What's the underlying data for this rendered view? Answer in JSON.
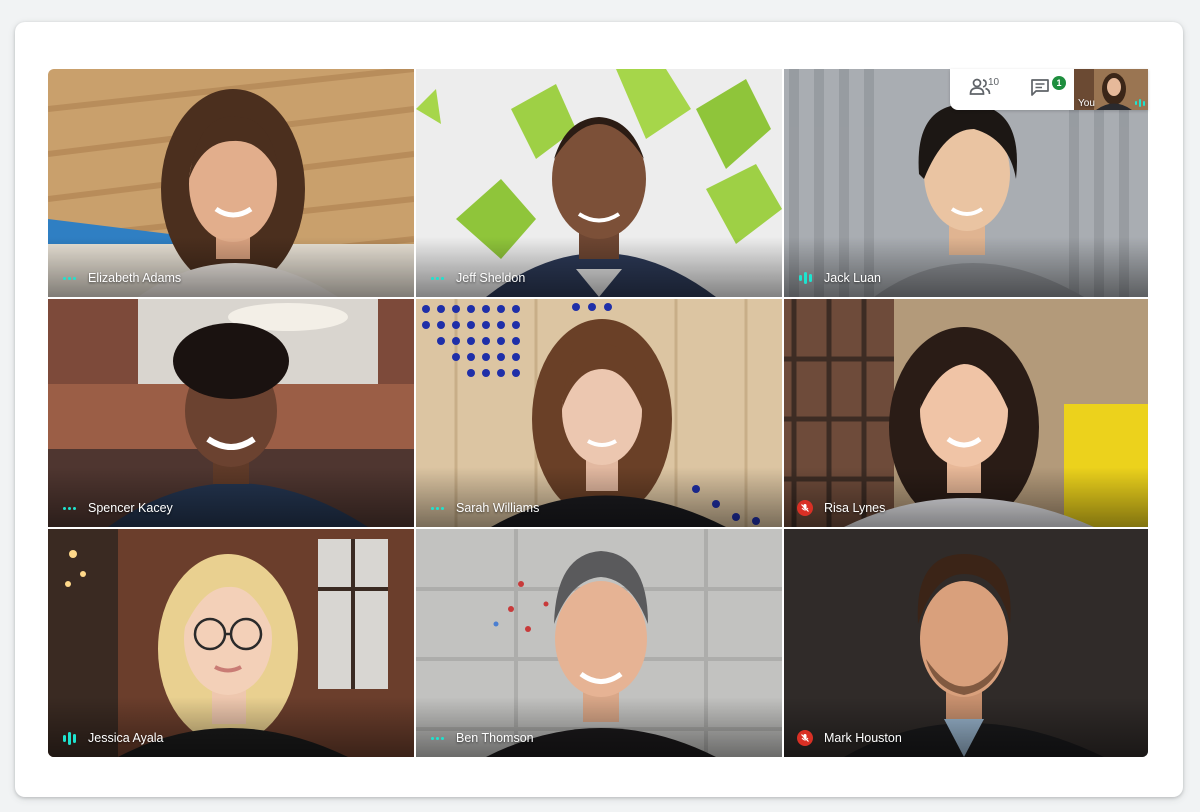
{
  "meeting": {
    "participants_count": "10",
    "chat_unread": "1",
    "self_label": "You"
  },
  "participants": [
    {
      "name": "Elizabeth Adams",
      "audio": "idle"
    },
    {
      "name": "Jeff Sheldon",
      "audio": "idle"
    },
    {
      "name": "Jack Luan",
      "audio": "speaking"
    },
    {
      "name": "Spencer Kacey",
      "audio": "idle"
    },
    {
      "name": "Sarah Williams",
      "audio": "idle"
    },
    {
      "name": "Risa Lynes",
      "audio": "muted"
    },
    {
      "name": "Jessica Ayala",
      "audio": "speaking"
    },
    {
      "name": "Ben Thomson",
      "audio": "idle"
    },
    {
      "name": "Mark Houston",
      "audio": "muted"
    }
  ],
  "icons": {
    "people": "people-icon",
    "chat": "chat-icon",
    "muted": "mic-off-icon",
    "speaking": "audio-level-icon",
    "idle": "audio-idle-icon"
  },
  "colors": {
    "audio_indicator": "#1ee3cf",
    "muted_badge": "#d93025",
    "chat_badge": "#1e8e3e"
  }
}
